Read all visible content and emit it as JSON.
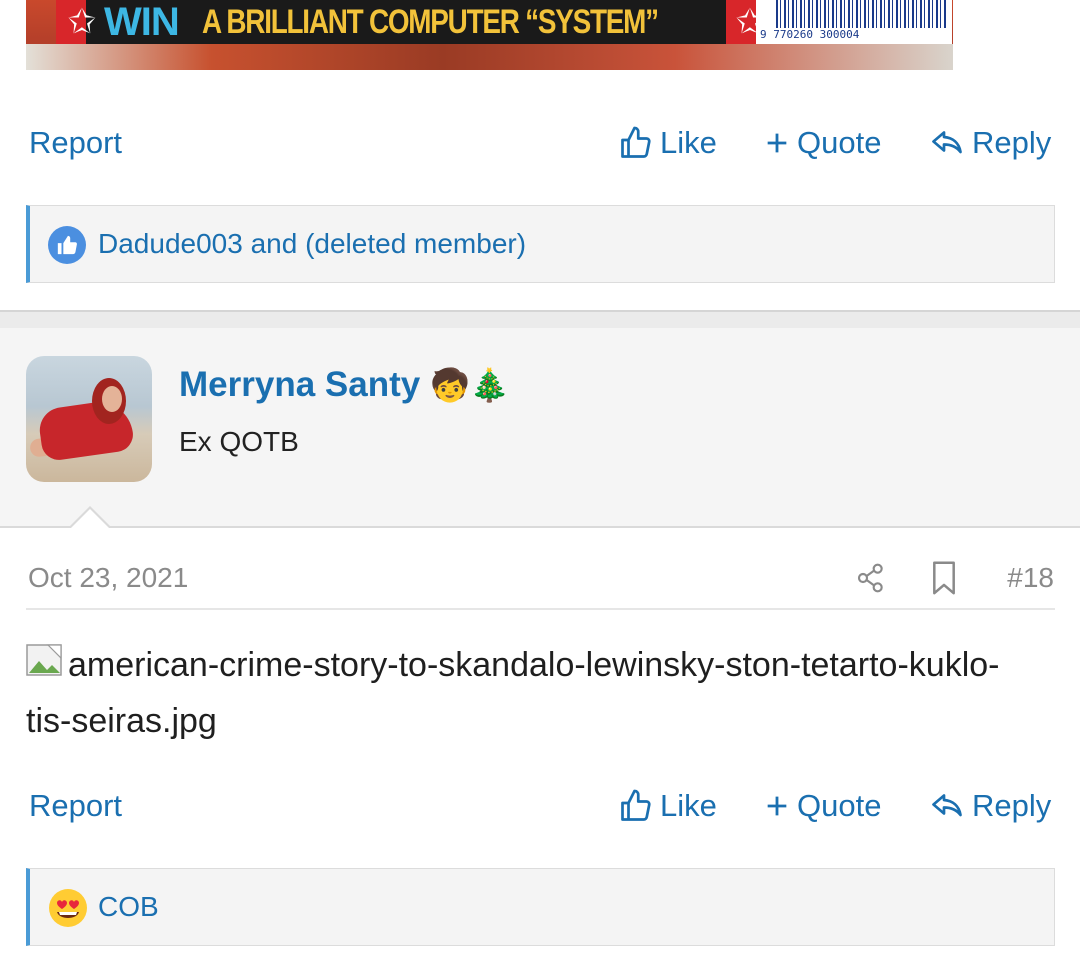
{
  "banner": {
    "win_text": "WIN",
    "tagline": "A BRILLIANT COMPUTER “SYSTEM”",
    "barcode_number": "9 770260 300004"
  },
  "post1": {
    "actions": {
      "report": "Report",
      "like": "Like",
      "quote": "Quote",
      "reply": "Reply"
    },
    "reactions": {
      "text": "Dadude003 and (deleted member)",
      "icon": "like-badge-icon"
    }
  },
  "post2": {
    "user": {
      "name": "Merryna Santy",
      "emoji": "🧒🎄",
      "title": "Ex QOTB"
    },
    "date": "Oct 23, 2021",
    "number": "#18",
    "image_alt": "american-crime-story-to-skandalo-lewinsky-ston-tetarto-kuklo-tis-seiras.jpg",
    "actions": {
      "report": "Report",
      "like": "Like",
      "quote": "Quote",
      "reply": "Reply"
    },
    "reactions": {
      "text": "COB",
      "icon": "heart-eyes-emoji-icon"
    }
  },
  "colors": {
    "link": "#1a6fb0",
    "reaction_accent": "#4a9bd6",
    "meta_gray": "#8a8a8a"
  }
}
